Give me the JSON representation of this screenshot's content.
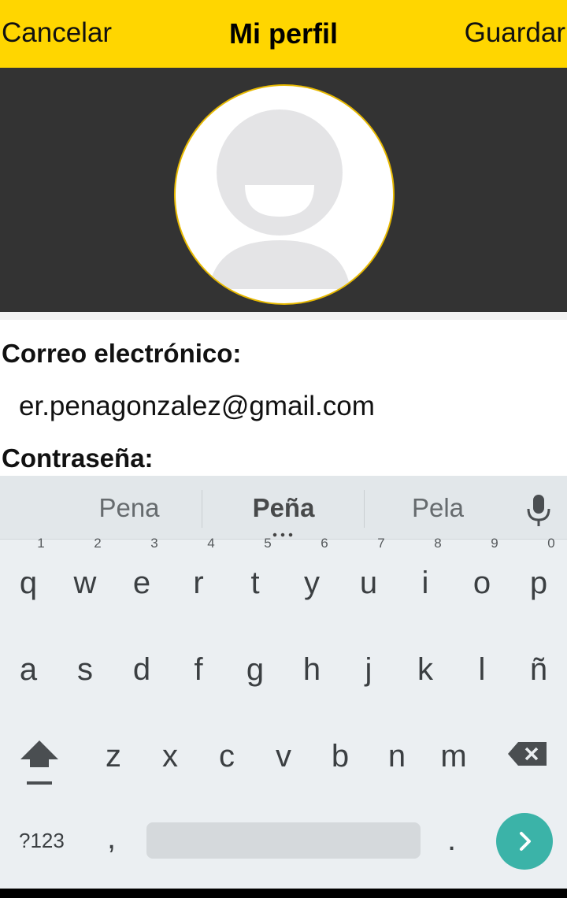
{
  "header": {
    "cancel_label": "Cancelar",
    "title": "Mi perfil",
    "save_label": "Guardar"
  },
  "colors": {
    "header_bg": "#FFD600",
    "banner_bg": "#333333",
    "avatar_border": "#E6B800",
    "keyboard_bg": "#EBEFF2",
    "enter_key": "#3BB3A8"
  },
  "form": {
    "email_label": "Correo electrónico:",
    "email_value": "er.penagonzalez@gmail.com",
    "password_label": "Contraseña:"
  },
  "keyboard": {
    "suggestions": [
      "Pena",
      "Peña",
      "Pela"
    ],
    "row1": [
      {
        "key": "q",
        "num": "1"
      },
      {
        "key": "w",
        "num": "2"
      },
      {
        "key": "e",
        "num": "3"
      },
      {
        "key": "r",
        "num": "4"
      },
      {
        "key": "t",
        "num": "5"
      },
      {
        "key": "y",
        "num": "6"
      },
      {
        "key": "u",
        "num": "7"
      },
      {
        "key": "i",
        "num": "8"
      },
      {
        "key": "o",
        "num": "9"
      },
      {
        "key": "p",
        "num": "0"
      }
    ],
    "row2": [
      "a",
      "s",
      "d",
      "f",
      "g",
      "h",
      "j",
      "k",
      "l",
      "ñ"
    ],
    "row3": [
      "z",
      "x",
      "c",
      "v",
      "b",
      "n",
      "m"
    ],
    "symbols_label": "?123",
    "comma_label": ",",
    "period_label": ".",
    "icons": [
      "mic-icon",
      "shift-icon",
      "backspace-icon",
      "enter-arrow-icon"
    ]
  }
}
